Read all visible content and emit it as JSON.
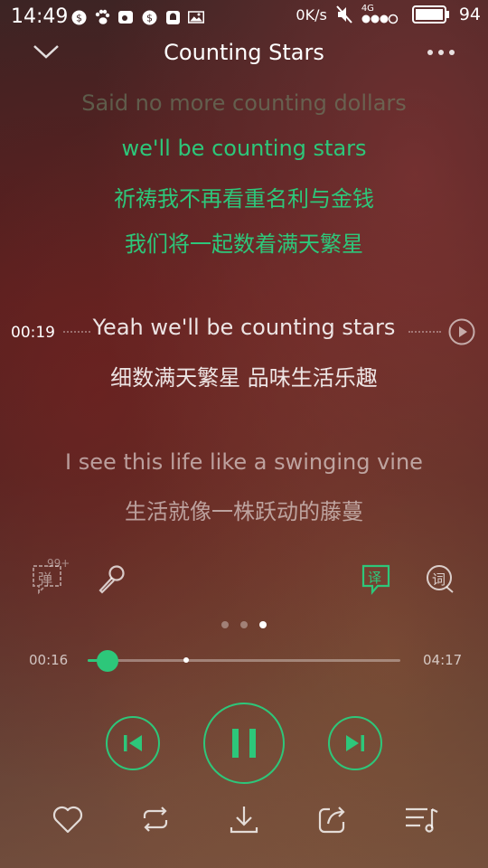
{
  "status_bar": {
    "time": "14:49",
    "net_speed": "0K/s",
    "network": "4G",
    "battery": "94",
    "icons": [
      "sync-icon",
      "paw-icon",
      "weibo-icon",
      "sync-icon",
      "notification-icon",
      "image-icon"
    ]
  },
  "header": {
    "title": "Counting Stars"
  },
  "lyrics": {
    "faded_line": "Said no more counting dollars",
    "green_line_en": "we'll be counting stars",
    "green_line_zh_1": "祈祷我不再看重名利与金钱",
    "green_line_zh_2": "我们将一起数着满天繁星",
    "current_time_tag": "00:19",
    "current_line_en": "Yeah  we'll be counting stars",
    "current_line_zh": "细数满天繁星 品味生活乐趣",
    "next_line_en": "I see this life like a swinging vine",
    "next_line_zh": "生活就像一株跃动的藤蔓"
  },
  "tools": {
    "danmu_label": "弹",
    "danmu_badge": "99+",
    "translate_label": "译",
    "lyric_label": "词"
  },
  "pager": {
    "count": 3,
    "active_index": 2
  },
  "progress": {
    "current": "00:16",
    "total": "04:17",
    "played_fraction": 0.0623,
    "buffered_fraction": 0.3142
  },
  "colors": {
    "accent": "#2dc77a"
  }
}
